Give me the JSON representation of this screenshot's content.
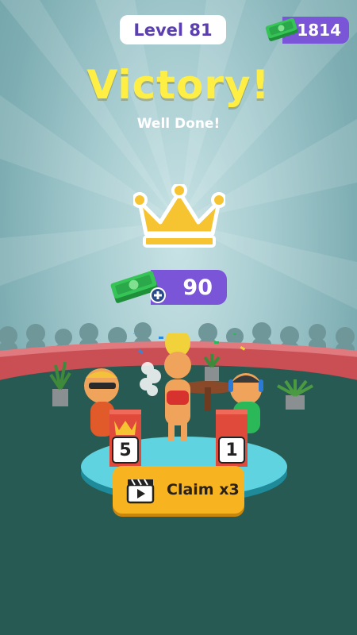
{
  "header": {
    "level_label": "Level 81",
    "money_balance": "1814",
    "money_icon": "cash-stack-icon"
  },
  "result": {
    "title": "Victory!",
    "subtitle": "Well Done!",
    "badge_icon": "crown-icon"
  },
  "reward": {
    "amount": "90",
    "icon": "cash-plus-icon"
  },
  "podium": {
    "left_rank": "5",
    "right_rank": "1"
  },
  "claim_button": {
    "label": "Claim x3",
    "icon": "video-clapper-icon"
  },
  "colors": {
    "accent_purple": "#7a55d8",
    "title_yellow": "#ffef45",
    "button_orange": "#f7b420",
    "floor_green": "#275a52"
  }
}
